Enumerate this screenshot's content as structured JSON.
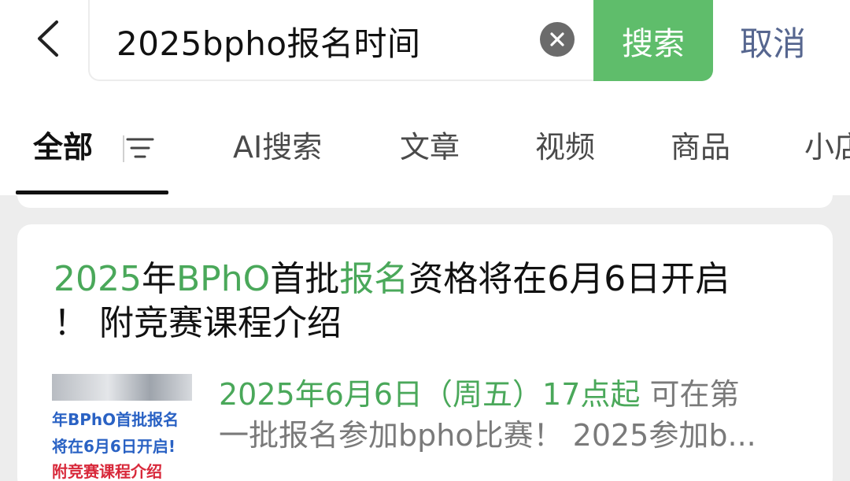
{
  "header": {
    "search_value": "2025bpho报名时间",
    "search_button_label": "搜索",
    "cancel_label": "取消"
  },
  "tabs": [
    {
      "label": "全部"
    },
    {
      "label": "AI搜索"
    },
    {
      "label": "文章"
    },
    {
      "label": "视频"
    },
    {
      "label": "商品"
    },
    {
      "label": "小店"
    }
  ],
  "result": {
    "title_parts": [
      {
        "text": "2025",
        "highlight": true
      },
      {
        "text": "年",
        "highlight": false
      },
      {
        "text": "BPhO",
        "highlight": true
      },
      {
        "text": "首批",
        "highlight": false
      },
      {
        "text": "报名",
        "highlight": true
      },
      {
        "text": "资格将在6月6日开启",
        "highlight": false
      }
    ],
    "title_line2": "！ 附竞赛课程介绍",
    "thumbnail_lines": [
      "年BPhO首批报名",
      "将在6月6日开启!",
      "附竞赛课程介绍"
    ],
    "desc_highlight": "2025年6月6日（周五）17点起",
    "desc_rest": " 可在第",
    "desc_line2": "一批报名参加bpho比赛！ 2025参加b..."
  },
  "colors": {
    "accent_green": "#5fbd6b",
    "highlight_green": "#4aa85a",
    "cancel_blue": "#56668f"
  }
}
